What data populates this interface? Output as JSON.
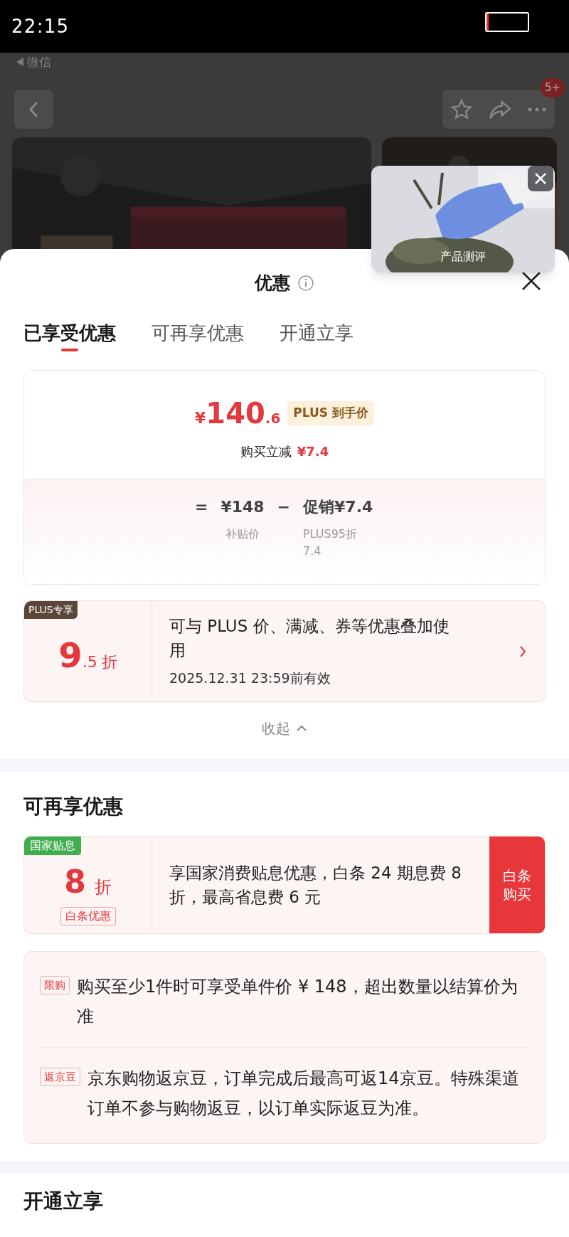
{
  "status_bar": {
    "time": "22:15"
  },
  "background": {
    "back_app": "微信",
    "badge": "5+"
  },
  "video": {
    "caption": "产品测评"
  },
  "sheet": {
    "title": "优惠",
    "tabs": [
      {
        "label": "已享受优惠",
        "selected": true
      },
      {
        "label": "可再享优惠",
        "selected": false
      },
      {
        "label": "开通立享",
        "selected": false
      }
    ],
    "price_card": {
      "currency": "¥",
      "price_int": "140",
      "price_dec": ".6",
      "price_tag": "PLUS 到手价",
      "cut_label": "购买立减",
      "cut_value": "¥7.4",
      "equals": "=",
      "base_value": "¥148",
      "base_label": "补贴价",
      "minus": "−",
      "promo_value": "促销¥7.4",
      "promo_note": "PLUS95折 7.4"
    },
    "plus_coupon": {
      "tag": "PLUS专享",
      "big": "9",
      "small": ".5",
      "unit": "折",
      "desc": "可与 PLUS 价、满减、券等优惠叠加使用",
      "validity": "2025.12.31 23:59前有效"
    },
    "collapse": "收起",
    "more_title": "可再享优惠",
    "loan_coupon": {
      "tag": "国家贴息",
      "big": "8",
      "unit": "折",
      "sub_tag": "白条优惠",
      "desc": "享国家消费贴息优惠，白条 24 期息费 8 折，最高省息费 6 元",
      "action": "白条购买"
    },
    "notes": [
      {
        "tag": "限购",
        "text": "购买至少1件时可享受单件价 ¥ 148，超出数量以结算价为准"
      },
      {
        "tag": "返京豆",
        "text": "京东购物返京豆，订单完成后最高可返14京豆。特殊渠道订单不参与购物返豆，以订单实际返豆为准。"
      }
    ],
    "open_title": "开通立享"
  }
}
